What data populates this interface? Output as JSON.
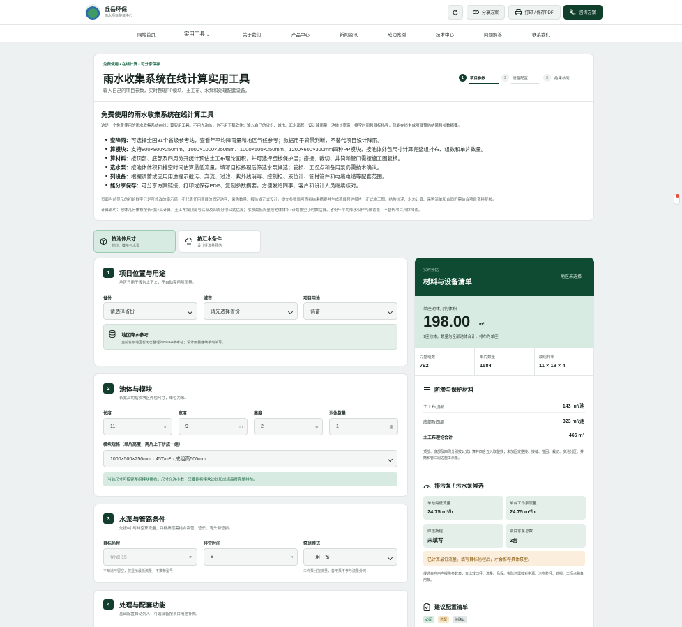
{
  "brand": {
    "name": "丘岳环保",
    "tagline": "雨水项目整体中心"
  },
  "toolbar": {
    "refresh_label": "",
    "share_label": "分享方案",
    "print_label": "打印 / 保存PDF",
    "consult_label": "咨询方案"
  },
  "nav": [
    "网站首页",
    "实用工具",
    "关于我们",
    "产品中心",
    "新闻资讯",
    "成功案例",
    "技术中心",
    "问题解答",
    "联系我们"
  ],
  "hero": {
    "badge": "免费使用 • 在线计算 • 可分享保存",
    "title": "雨水收集系统在线计算实用工具",
    "subtitle": "输入自己的项目参数，实时整理PP模块、土工布、水泵和处理配套设备。",
    "steps": [
      {
        "num": "1",
        "label": "项目参数"
      },
      {
        "num": "2",
        "label": "设备配置"
      },
      {
        "num": "3",
        "label": "结果核对"
      }
    ]
  },
  "intro": {
    "title": "免费使用的雨水收集系统在线计算工具",
    "desc": "这是一个免费使用的雨水收集系统在线计算实用工具。不用先询价，也不用下载软件；输入自己的省份、城市、汇水面积、设计降雨量、池体长宽高、排空时间和目标扬程，就能在线生成项目预估结果和参数摘要。",
    "features": [
      {
        "k": "查降雨：",
        "v": "可选择全国31个省级参考站，查看年平均降雨量和地区气候参考；数据用于背景判断，不替代项目设计降雨。"
      },
      {
        "k": "算模块：",
        "v": "支持800×800×250mm、1000×1000×250mm、1000×500×250mm、1200×600×300mm四种PP模块，按池体外包尺寸计算完整组排布、组数和单片数量。"
      },
      {
        "k": "算材料：",
        "v": "按顶部、底部及四周分开统计预估土工布理论面积，并可选择塑板保护层；搭接、裁切、井筒和管口需按施工图复核。"
      },
      {
        "k": "选水泵：",
        "v": "按池体体积和排空时间估算最低流量，填写目标扬程后筛选水泵候选；管损、工况点和备用泵仍需技术确认。"
      },
      {
        "k": "列设备：",
        "v": "根据调蓄或回用用途提示截污、弃流、过滤、紫外线消毒、控制柜、液位计、管材管件和电缆电缆等配套范围。"
      },
      {
        "k": "能分享保存：",
        "v": "可分享方案链接、打印或保存PDF、复制参数摘要，方便发给同事、客户和设计人员继续核对。"
      }
    ],
    "note1": "页面当前显示的初始数字只是可修改的演示值，不代表任何项目的固定池容、采购数量、报价或正式设计。提交参数后可查看结果摘要并生成项目预估报告；正式施工图、结构抗浮、水力计算、采购清单和合同仍需结合项目资料复核。",
    "note2": "计算说明：池体几何体积按长×宽×高计算；土工布按顶部与底部及四周分项公式估算；水泵最低流量按池体体积÷计划排空小时数估算。省份年平均降水仅作气候背景，不替代项目具体降雨。"
  },
  "tabs": [
    {
      "title": "按池体尺寸",
      "sub": "材料、模块与水泵",
      "active": true
    },
    {
      "title": "按汇水条件",
      "sub": "设计径流量预估",
      "active": false
    }
  ],
  "sections": {
    "s1": {
      "num": "1",
      "title": "项目位置与用途",
      "sub": "地区只用于报告上下文，不自动套用降雨量。",
      "province_label": "省份",
      "province": "请选择省份",
      "city_label": "城市",
      "city": "请先选择省份",
      "use_label": "项目用途",
      "use": "调蓄",
      "rain_title": "地区降水参考",
      "rain_desc": "当前省级地区暂无已整理的NOAA参考站；设计雨量继续手动填写。"
    },
    "s2": {
      "num": "2",
      "title": "池体与模块",
      "sub": "长宽高均指模块区外包尺寸，单位为米。",
      "len_label": "长度",
      "len": "11",
      "wid_label": "宽度",
      "wid": "9",
      "hei_label": "高度",
      "hei": "2",
      "cnt_label": "池体数量",
      "cnt": "1",
      "unit_m": "m",
      "unit_pool": "座",
      "spec_label": "模块规格（单片高度，两片上下拼成一组）",
      "spec": "1000×500×250mm · 45T/m² · 成组高500mm",
      "ok_msg": "当前尺寸可按完整组模块排布。尺寸允许小数，只要能按模块边长和成组高度完整排布。"
    },
    "s3": {
      "num": "3",
      "title": "水泵与管路条件",
      "sub": "先按8小时排空算流量；目标扬程需结合高差、管长、弯头和管损。",
      "head_label": "目标扬程",
      "head_ph": "例如 15",
      "head_unit": "m",
      "head_hint": "不知道可留空，仅显示最低流量，不推荐型号",
      "time_label": "排空时间",
      "time": "8",
      "time_unit": "h",
      "mode_label": "泵组模式",
      "mode": "一用一备",
      "mode_hint": "工作泵分担流量，备用泵不参与流量分摊"
    },
    "s4": {
      "num": "4",
      "title": "处理与配套功能",
      "sub": "基础配置自动列入；可选设备按项目用途补充。"
    }
  },
  "result": {
    "tag": "实时预估",
    "title": "材料与设备清单",
    "region": "地区未选择",
    "vol_label": "单座池体几何体积",
    "vol": "198.00",
    "vol_unit": "m³",
    "vol_note": "1座池体，数量为全部池体合计，排布为单座",
    "metrics": [
      {
        "l": "完整组数",
        "v": "792"
      },
      {
        "l": "单片数量",
        "v": "1584"
      },
      {
        "l": "成组排布",
        "v": "11 × 18 × 4"
      }
    ],
    "geo_title": "防渗与保护材料",
    "geo": [
      {
        "l": "土工布顶部",
        "v": "143 m²/池"
      },
      {
        "l": "底部及四周",
        "v": "323 m²/池"
      },
      {
        "l": "土工布理论合计",
        "v": "466 m²"
      }
    ],
    "geo_note": "顶部、底部及四周分别按公式计算并四舍五入取整数；未加固定搭接、接缝、锚固、裁切、多池分区、井筒和管口周边施工余量。",
    "pump_title": "排污泵 / 污水泵候选",
    "pumps": [
      {
        "l": "单池最低流量",
        "v": "24.75 m³/h"
      },
      {
        "l": "单台工作泵流量",
        "v": "24.75 m³/h"
      },
      {
        "l": "筛选扬程",
        "v": "未填写"
      },
      {
        "l": "项目水泵总数",
        "v": "2台"
      }
    ],
    "pump_warn": "已计算最低流量。填写目标扬程后，才会推荐具体泵型。",
    "pump_note": "候选来自用户提供参数表，只比较口径、流量、扬程。实际还需核对电源、污物粒径、管损、工况点和备用泵。",
    "cfg_title": "建议配置清单",
    "chips": [
      {
        "t": "必配",
        "bg": "#d8ebe2",
        "c": "#1f6a49"
      },
      {
        "t": "选配",
        "bg": "#f6e7c8",
        "c": "#8a5a10"
      },
      {
        "t": "待确认",
        "bg": "#e4e8e6",
        "c": "#3b4743"
      }
    ]
  },
  "colors": {
    "accent": "#123f2d",
    "accent_light": "#d8ebe2",
    "warn": "#fbeedd"
  }
}
